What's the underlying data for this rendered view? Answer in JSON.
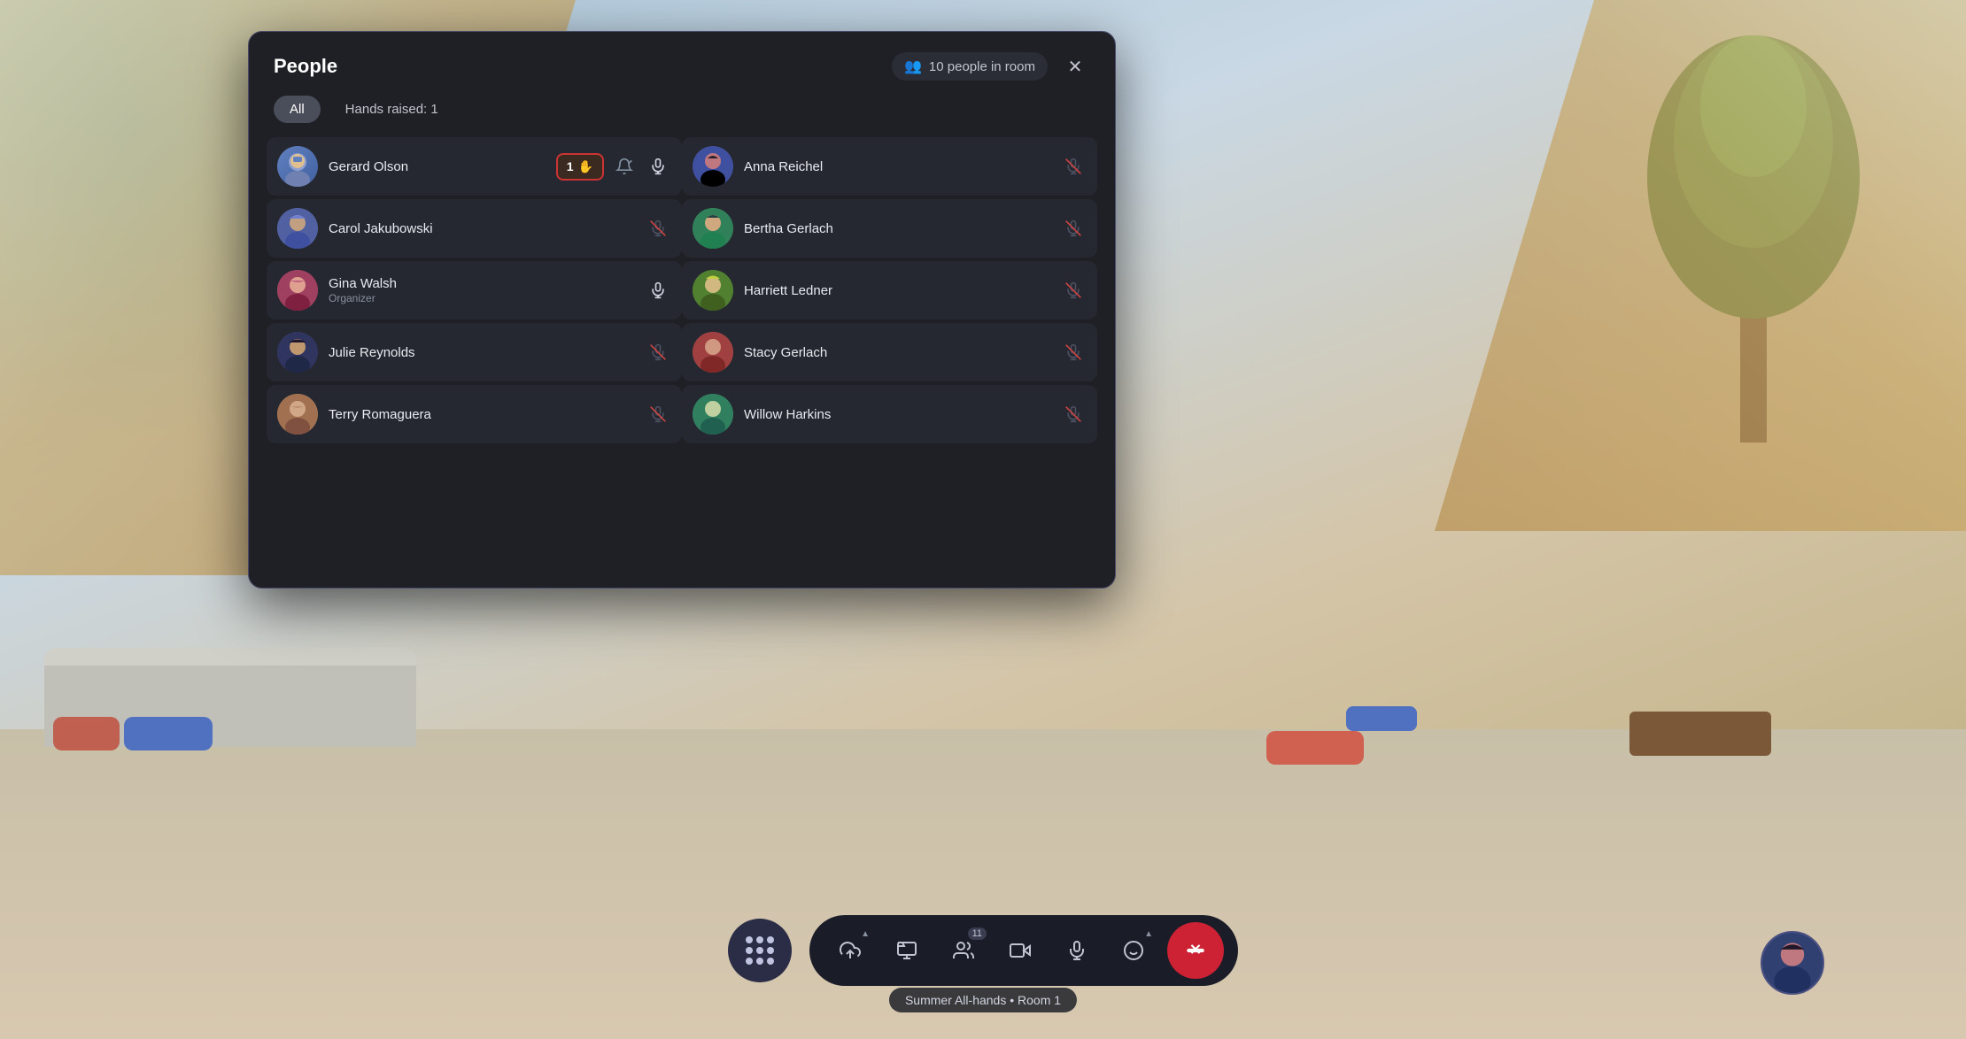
{
  "background": {
    "color": "#b8c9d8"
  },
  "dialog": {
    "title": "People",
    "people_count": "10 people in room",
    "tabs": {
      "all_label": "All",
      "hands_label": "Hands raised: 1"
    },
    "people": [
      {
        "id": "gerard",
        "name": "Gerard Olson",
        "role": "",
        "hand_raised": true,
        "hand_count": "1",
        "mic": "active",
        "col": "left"
      },
      {
        "id": "anna",
        "name": "Anna Reichel",
        "role": "",
        "hand_raised": false,
        "mic": "muted",
        "col": "right"
      },
      {
        "id": "carol",
        "name": "Carol Jakubowski",
        "role": "",
        "hand_raised": false,
        "mic": "muted",
        "col": "left"
      },
      {
        "id": "bertha",
        "name": "Bertha Gerlach",
        "role": "",
        "hand_raised": false,
        "mic": "muted",
        "col": "right"
      },
      {
        "id": "gina",
        "name": "Gina Walsh",
        "role": "Organizer",
        "hand_raised": false,
        "mic": "active",
        "col": "left"
      },
      {
        "id": "harriett",
        "name": "Harriett Ledner",
        "role": "",
        "hand_raised": false,
        "mic": "muted",
        "col": "right"
      },
      {
        "id": "julie",
        "name": "Julie Reynolds",
        "role": "",
        "hand_raised": false,
        "mic": "muted",
        "col": "left"
      },
      {
        "id": "stacy",
        "name": "Stacy Gerlach",
        "role": "",
        "hand_raised": false,
        "mic": "muted",
        "col": "right"
      },
      {
        "id": "terry",
        "name": "Terry Romaguera",
        "role": "",
        "hand_raised": false,
        "mic": "muted",
        "col": "left"
      },
      {
        "id": "willow",
        "name": "Willow Harkins",
        "role": "",
        "hand_raised": false,
        "mic": "muted",
        "col": "right"
      }
    ]
  },
  "toolbar": {
    "share_label": "⬆",
    "content_label": "🎬",
    "people_label": "👤",
    "people_count": "11",
    "camera_label": "📷",
    "mic_label": "🎙",
    "emoji_label": "😊",
    "end_label": "⏹",
    "room_info": "Summer All-hands • Room 1"
  },
  "icons": {
    "hand": "✋",
    "bell": "🔔",
    "mic_active": "🎙",
    "mic_muted": "🎙",
    "close": "✕",
    "people": "👥",
    "dots": "⋯"
  }
}
